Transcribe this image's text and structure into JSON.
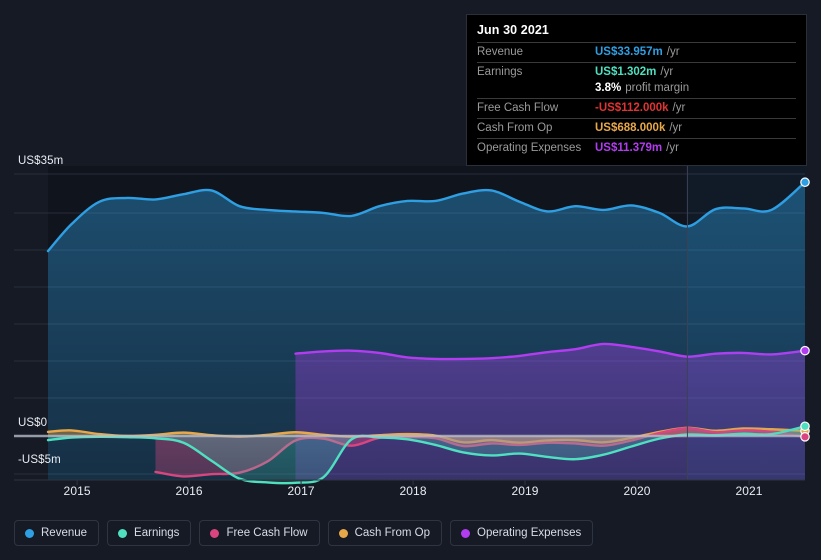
{
  "colors": {
    "background": "#151a25",
    "plot_background": "#10141d",
    "revenue": "#2f9fe3",
    "earnings": "#4fe0c0",
    "free_cash_flow": "#d9457f",
    "cash_from_op": "#e8a84a",
    "operating_expenses": "#b23df0",
    "zero_line": "#b9c0cc",
    "grid": "#272d3a",
    "tooltip_negative": "#e03434"
  },
  "tooltip": {
    "date": "Jun 30 2021",
    "rows": [
      {
        "key": "Revenue",
        "value": "US$33.957m",
        "unit": "/yr",
        "color": "#2f9fe3"
      },
      {
        "key": "Earnings",
        "value": "US$1.302m",
        "unit": "/yr",
        "color": "#4fe0c0"
      },
      {
        "key": "",
        "value": "3.8%",
        "unit": "profit margin",
        "color": "#ffffff"
      },
      {
        "key": "Free Cash Flow",
        "value": "-US$112.000k",
        "unit": "/yr",
        "color": "#e03434"
      },
      {
        "key": "Cash From Op",
        "value": "US$688.000k",
        "unit": "/yr",
        "color": "#e8a84a"
      },
      {
        "key": "Operating Expenses",
        "value": "US$11.379m",
        "unit": "/yr",
        "color": "#b23df0"
      }
    ]
  },
  "legend": {
    "items": [
      {
        "label": "Revenue",
        "color": "#2f9fe3"
      },
      {
        "label": "Earnings",
        "color": "#4fe0c0"
      },
      {
        "label": "Free Cash Flow",
        "color": "#d9457f"
      },
      {
        "label": "Cash From Op",
        "color": "#e8a84a"
      },
      {
        "label": "Operating Expenses",
        "color": "#b23df0"
      }
    ]
  },
  "chart_data": {
    "type": "area",
    "title": "",
    "xlabel": "",
    "ylabel": "",
    "grid": true,
    "legend_position": "bottom",
    "y_ticks": [
      {
        "label": "US$35m",
        "value": 35
      },
      {
        "label": "US$0",
        "value": 0
      },
      {
        "label": "-US$5m",
        "value": -5
      }
    ],
    "ylim": [
      -7,
      37
    ],
    "x_ticks": [
      "2015",
      "2016",
      "2017",
      "2018",
      "2019",
      "2020",
      "2021"
    ],
    "xlim": [
      2014.74,
      2021.5
    ],
    "x": [
      2014.74,
      2014.95,
      2015.2,
      2015.45,
      2015.7,
      2015.95,
      2016.2,
      2016.45,
      2016.7,
      2016.95,
      2017.2,
      2017.45,
      2017.7,
      2017.95,
      2018.2,
      2018.45,
      2018.7,
      2018.95,
      2019.2,
      2019.45,
      2019.7,
      2019.95,
      2020.2,
      2020.45,
      2020.7,
      2020.95,
      2021.2,
      2021.5
    ],
    "series": [
      {
        "name": "Revenue",
        "color": "#2f9fe3",
        "values": [
          24.7,
          28.3,
          31.3,
          31.8,
          31.6,
          32.3,
          32.8,
          30.7,
          30.2,
          30.0,
          29.8,
          29.4,
          30.7,
          31.4,
          31.4,
          32.4,
          32.8,
          31.3,
          30.0,
          30.7,
          30.2,
          30.8,
          29.8,
          28.0,
          30.3,
          30.4,
          30.2,
          33.9
        ],
        "end_label": "US$33.957m"
      },
      {
        "name": "Operating Expenses",
        "color": "#b23df0",
        "start_index": 9,
        "values": [
          null,
          null,
          null,
          null,
          null,
          null,
          null,
          null,
          null,
          11.0,
          11.3,
          11.4,
          11.1,
          10.5,
          10.3,
          10.3,
          10.4,
          10.7,
          11.2,
          11.6,
          12.3,
          11.9,
          11.3,
          10.6,
          11.0,
          11.1,
          10.9,
          11.4
        ],
        "end_label": "US$11.379m"
      },
      {
        "name": "Cash From Op",
        "color": "#e8a84a",
        "values": [
          0.55,
          0.75,
          0.25,
          0.0,
          0.15,
          0.45,
          0.1,
          -0.1,
          0.15,
          0.5,
          0.15,
          -0.1,
          0.1,
          0.25,
          0.05,
          -0.85,
          -0.55,
          -0.9,
          -0.6,
          -0.55,
          -0.85,
          -0.25,
          0.55,
          1.1,
          0.7,
          1.0,
          0.9,
          0.69
        ],
        "end_label": "US$688.000k"
      },
      {
        "name": "Free Cash Flow",
        "color": "#d9457f",
        "start_index": 4,
        "values": [
          null,
          null,
          null,
          null,
          -4.8,
          -5.4,
          -5.1,
          -4.9,
          -3.4,
          -0.6,
          -0.35,
          -1.3,
          -0.25,
          -0.15,
          -0.3,
          -1.35,
          -1.0,
          -1.2,
          -0.9,
          -1.0,
          -1.3,
          -0.6,
          0.4,
          1.05,
          0.5,
          0.75,
          0.55,
          -0.11
        ],
        "end_label": "-US$112.000k"
      },
      {
        "name": "Earnings",
        "color": "#4fe0c0",
        "values": [
          -0.55,
          -0.2,
          -0.1,
          -0.15,
          -0.3,
          -0.9,
          -3.3,
          -5.7,
          -6.2,
          -6.25,
          -5.5,
          -0.45,
          -0.2,
          -0.45,
          -1.2,
          -2.2,
          -2.6,
          -2.35,
          -2.8,
          -3.1,
          -2.5,
          -1.4,
          -0.35,
          0.2,
          0.1,
          0.3,
          0.25,
          1.3
        ],
        "end_label": "US$1.302m"
      }
    ],
    "forecast_divider_x": 2020.45
  }
}
